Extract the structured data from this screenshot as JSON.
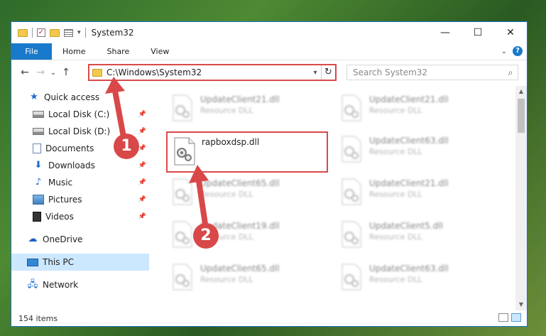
{
  "window": {
    "title": "System32",
    "controls": {
      "minimize": "—",
      "maximize": "☐",
      "close": "✕"
    }
  },
  "ribbon": {
    "tabs": [
      "File",
      "Home",
      "Share",
      "View"
    ],
    "help_label": "?"
  },
  "nav": {
    "back": "←",
    "forward": "→",
    "recent": "⌄",
    "up": "↑",
    "address": "C:\\Windows\\System32",
    "refresh": "↻",
    "search_placeholder": "Search System32"
  },
  "sidebar": {
    "items": [
      {
        "label": "Quick access",
        "icon": "star-icon"
      },
      {
        "label": "Local Disk (C:)",
        "icon": "disk-icon",
        "pinned": true
      },
      {
        "label": "Local Disk (D:)",
        "icon": "disk-icon",
        "pinned": true
      },
      {
        "label": "Documents",
        "icon": "documents-icon",
        "pinned": true
      },
      {
        "label": "Downloads",
        "icon": "download-icon",
        "pinned": true
      },
      {
        "label": "Music",
        "icon": "music-icon",
        "pinned": true
      },
      {
        "label": "Pictures",
        "icon": "pictures-icon",
        "pinned": true
      },
      {
        "label": "Videos",
        "icon": "videos-icon",
        "pinned": true
      },
      {
        "label": "OneDrive",
        "icon": "cloud-icon"
      },
      {
        "label": "This PC",
        "icon": "pc-icon",
        "selected": true
      },
      {
        "label": "Network",
        "icon": "network-icon"
      }
    ]
  },
  "files": [
    {
      "name": "UpdateClient21.dll",
      "type": "Resource DLL"
    },
    {
      "name": "UpdateClient21.dll",
      "type": "Resource DLL"
    },
    {
      "name": "rapboxdsp.dll",
      "type": ""
    },
    {
      "name": "UpdateClient63.dll",
      "type": "Resource DLL"
    },
    {
      "name": "UpdateClient65.dll",
      "type": "Resource DLL"
    },
    {
      "name": "UpdateClient21.dll",
      "type": "Resource DLL"
    },
    {
      "name": "UpdateClient19.dll",
      "type": "Resource DLL"
    },
    {
      "name": "UpdateClient5.dll",
      "type": "Resource DLL"
    },
    {
      "name": "UpdateClient65.dll",
      "type": "Resource DLL"
    },
    {
      "name": "UpdateClient63.dll",
      "type": "Resource DLL"
    }
  ],
  "status": {
    "item_count": "154 items"
  },
  "annotations": {
    "step1": "1",
    "step2": "2"
  },
  "colors": {
    "accent": "#1979ca",
    "highlight": "#d94a4a",
    "selection": "#cce8ff"
  }
}
